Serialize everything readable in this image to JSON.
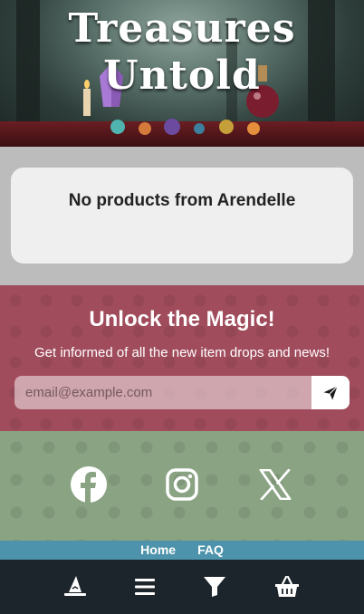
{
  "hero": {
    "title_line1": "Treasures",
    "title_line2": "Untold"
  },
  "message": {
    "text": "No products from Arendelle"
  },
  "newsletter": {
    "title": "Unlock the Magic!",
    "subtitle": "Get informed of all the new item drops and news!",
    "email_placeholder": "email@example.com",
    "send_icon": "paper-plane-icon"
  },
  "social": {
    "items": [
      {
        "icon": "facebook-icon"
      },
      {
        "icon": "instagram-icon"
      },
      {
        "icon": "x-icon"
      }
    ]
  },
  "footer": {
    "links": [
      "Home",
      "FAQ"
    ]
  },
  "bottom_nav": {
    "items": [
      {
        "icon": "wizard-hat-icon"
      },
      {
        "icon": "menu-icon"
      },
      {
        "icon": "filter-icon"
      },
      {
        "icon": "basket-icon"
      }
    ]
  },
  "colors": {
    "newsletter_bg": "#a04c5c",
    "social_bg": "#8aa383",
    "footer_bg": "#4d93ab",
    "nav_bg": "#1c252b"
  }
}
